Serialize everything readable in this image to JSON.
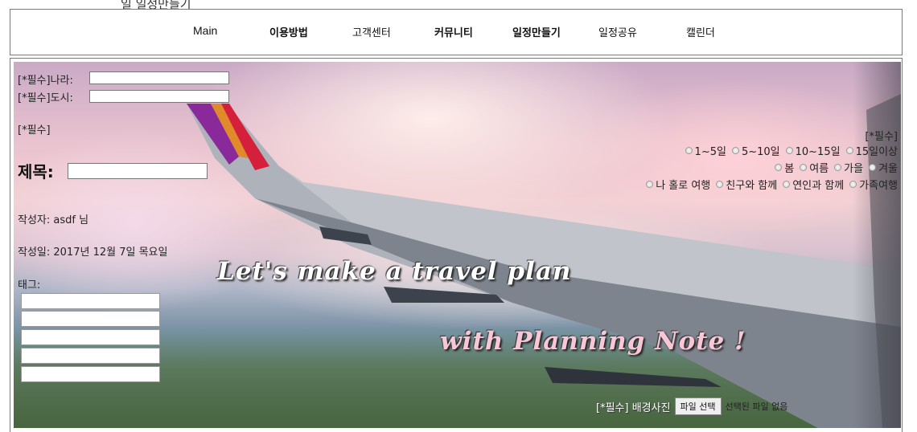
{
  "top_clip_text": "일 일정만들기",
  "nav": {
    "items": [
      {
        "label": "Main"
      },
      {
        "label": "이용방법"
      },
      {
        "label": "고객센터"
      },
      {
        "label": "커뮤니티"
      },
      {
        "label": "일정만들기"
      },
      {
        "label": "일정공유"
      },
      {
        "label": "캘린더"
      }
    ]
  },
  "form": {
    "country_label": "[*필수]나라:",
    "country_value": "",
    "city_label": "[*필수]도시:",
    "city_value": "",
    "required_note_left": "[*필수]",
    "title_label": "제목:",
    "title_value": "",
    "author_text": "작성자: asdf 님",
    "date_text": "작성일: 2017년 12월 7일 목요일",
    "tag_label": "태그:",
    "tags": [
      "",
      "",
      "",
      "",
      ""
    ],
    "required_note_right": "[*필수]",
    "duration_options": [
      "1~5일",
      "5~10일",
      "10~15일",
      "15일이상"
    ],
    "season_options": [
      "봄",
      "여름",
      "가을",
      "겨울"
    ],
    "companion_options": [
      "나 홀로 여행",
      "친구와 함께",
      "연인과 함께",
      "가족여행"
    ],
    "background_label": "[*필수] 배경사진",
    "file_button_label": "파일 선택",
    "file_status": "선택된 파일 없음"
  },
  "banner": {
    "line1": "Let's make a travel plan",
    "line2": "with Planning Note !"
  },
  "colors": {
    "border": "#7a7a7a",
    "slogan1": "#ffffff",
    "slogan2": "#f7c7d6"
  }
}
